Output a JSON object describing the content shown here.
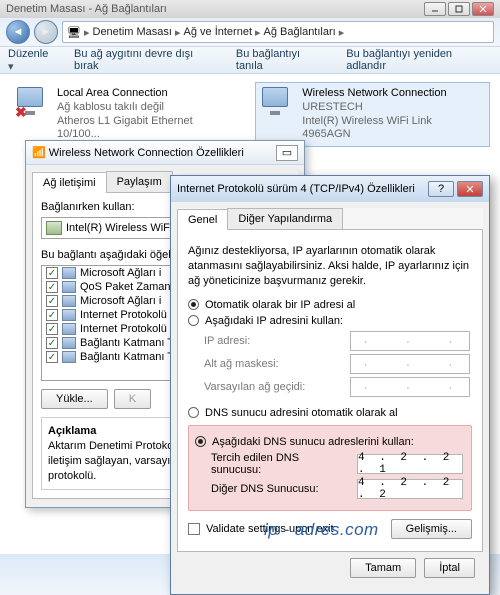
{
  "titlebar": {
    "title": "Denetim Masası - Ağ Bağlantıları"
  },
  "breadcrumb": {
    "items": [
      "Denetim Masası",
      "Ağ ve İnternet",
      "Ağ Bağlantıları"
    ]
  },
  "toolbar": {
    "menu_label": "Düzenle",
    "disable_label": "Bu ağ aygıtını devre dışı bırak",
    "diagnose_label": "Bu bağlantıyı tanıla",
    "rename_label": "Bu bağlantıyı yeniden adlandır"
  },
  "connections": [
    {
      "name": "Local Area Connection",
      "status": "Ağ kablosu takılı değil",
      "device": "Atheros L1 Gigabit Ethernet 10/100..."
    },
    {
      "name": "Wireless Network Connection",
      "status": "URESTECH",
      "device": "Intel(R) Wireless WiFi Link 4965AGN"
    }
  ],
  "propwin": {
    "title": "Wireless Network Connection Özellikleri",
    "tabs": {
      "net": "Ağ iletişimi",
      "share": "Paylaşım"
    },
    "connect_using_label": "Bağlanırken kullan:",
    "adapter": "Intel(R) Wireless WiF",
    "list_caption": "Bu bağlantı aşağıdaki öğeleri",
    "items": [
      "Microsoft Ağları i",
      "QoS Paket Zaman",
      "Microsoft Ağları i",
      "Internet Protokolü",
      "Internet Protokolü",
      "Bağlantı Katmanı T",
      "Bağlantı Katmanı T"
    ],
    "install_btn": "Yükle...",
    "uninstall_btn": "K",
    "desc_title": "Açıklama",
    "desc_text": "Aktarım Denetimi Protoko\niletişim sağlayan, varsayıl\nprotokolü."
  },
  "ipv4": {
    "title": "Internet Protokolü sürüm 4 (TCP/IPv4) Özellikleri",
    "tabs": {
      "general": "Genel",
      "alt": "Diğer Yapılandırma"
    },
    "explain": "Ağınız destekliyorsa, IP ayarlarının otomatik olarak atanmasını sağlayabilirsiniz. Aksi halde, IP ayarlarınız için ağ yöneticinize başvurmanız gerekir.",
    "ip_auto": "Otomatik olarak bir IP adresi al",
    "ip_manual": "Aşağıdaki IP adresini kullan:",
    "ip_rows": {
      "addr": "IP adresi:",
      "mask": "Alt ağ maskesi:",
      "gw": "Varsayılan ağ geçidi:"
    },
    "dns_auto": "DNS sunucu adresini otomatik olarak al",
    "dns_manual": "Aşağıdaki DNS sunucu adreslerini kullan:",
    "dns_rows": {
      "pref": "Tercih edilen DNS sunucusu:",
      "alt": "Diğer DNS Sunucusu:"
    },
    "dns_pref_value": "4 . 2 . 2 . 1",
    "dns_alt_value": "4 . 2 . 2 . 2",
    "validate": "Validate settings upon exit",
    "advanced": "Gelişmiş...",
    "ok": "Tamam",
    "cancel": "İptal"
  },
  "watermark": "ip - adres.com"
}
